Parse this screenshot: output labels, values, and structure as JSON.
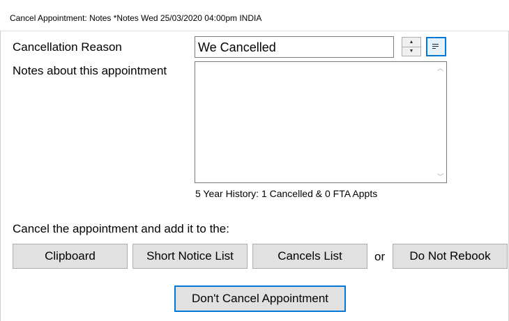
{
  "window": {
    "title": "Cancel Appointment: Notes *Notes Wed 25/03/2020 04:00pm INDIA"
  },
  "form": {
    "reason_label": "Cancellation Reason",
    "reason_value": "We Cancelled",
    "notes_label": "Notes about this appointment",
    "notes_value": "",
    "history": "5 Year History: 1 Cancelled & 0 FTA Appts",
    "cancel_prompt": "Cancel the appointment and add it to the:"
  },
  "icons": {
    "spin_up": "triangle-up",
    "spin_down": "triangle-down",
    "list": "list-lines-icon",
    "scroll_up": "chevron-up",
    "scroll_down": "chevron-down"
  },
  "buttons": {
    "clipboard": "Clipboard",
    "short_notice": "Short Notice List",
    "cancels_list": "Cancels List",
    "or_text": "or",
    "do_not_rebook": "Do Not Rebook",
    "dont_cancel": "Don't Cancel Appointment"
  },
  "colors": {
    "accent_border": "#0078d7",
    "button_face": "#e1e1e1",
    "button_border": "#adadad"
  }
}
